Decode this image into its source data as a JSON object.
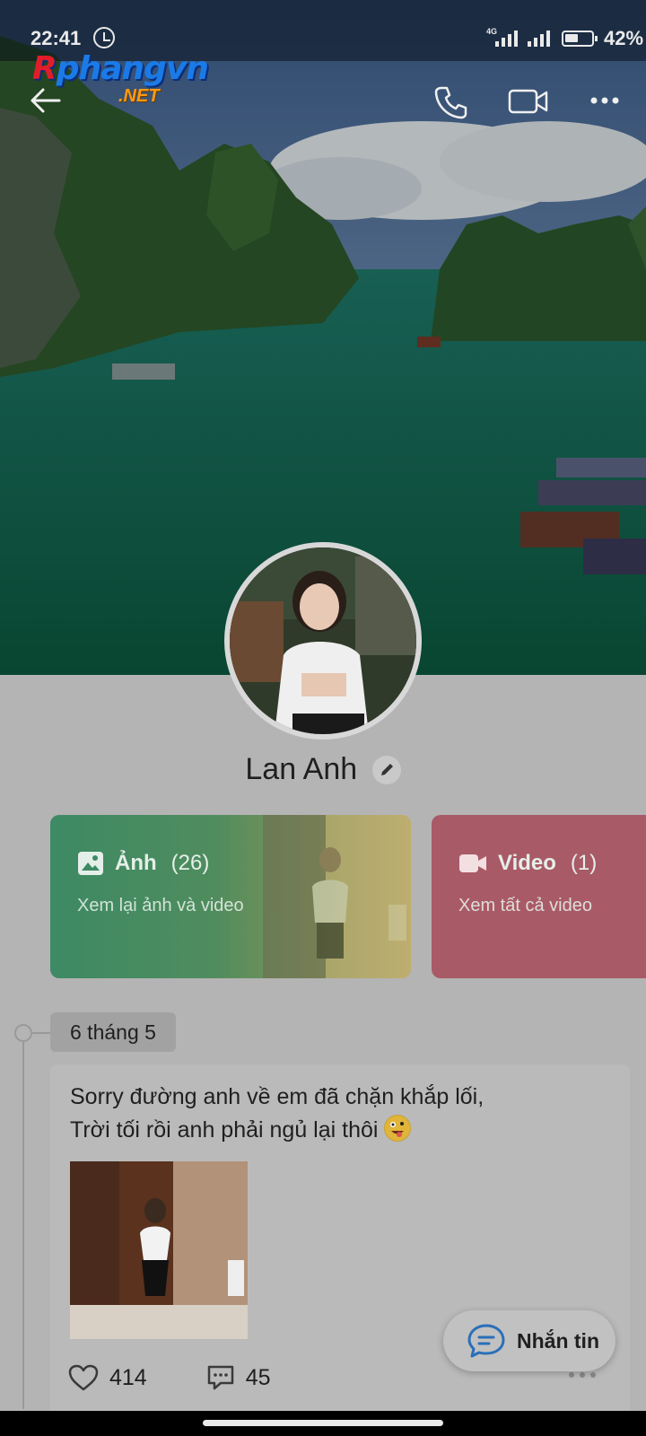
{
  "status_bar": {
    "time": "22:41",
    "network": "4G",
    "battery": "42%"
  },
  "watermark": {
    "main_red": "R",
    "main_blue": "phangvn",
    "sub": ".NET"
  },
  "profile": {
    "name": "Lan Anh"
  },
  "cards": [
    {
      "title": "Ảnh",
      "count": "(26)",
      "subtitle": "Xem lại ảnh và video"
    },
    {
      "title": "Video",
      "count": "(1)",
      "subtitle": "Xem tất cả video"
    }
  ],
  "timeline": {
    "date": "6 tháng 5"
  },
  "post": {
    "text": "Sorry đường anh về em đã chặn khắp lối,\nTrời tối rồi anh phải ngủ lại thôi",
    "likes": "414",
    "comments": "45"
  },
  "fab": {
    "label": "Nhắn tin"
  },
  "colors": {
    "photos_card": "#3d8a64",
    "videos_card": "#a95a67",
    "background": "#b4b4b4"
  },
  "icons": [
    "back-icon",
    "phone-icon",
    "video-call-icon",
    "more-icon",
    "edit-icon",
    "image-icon",
    "video-icon",
    "heart-icon",
    "comment-icon",
    "chat-icon"
  ]
}
